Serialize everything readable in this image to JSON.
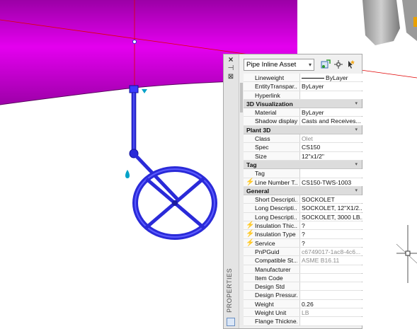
{
  "palette": {
    "title": "PROPERTIES",
    "selector_value": "Pipe Inline Asset",
    "close_glyph": "×",
    "autohide_glyph": "⊣",
    "properties_glyph": "⊠"
  },
  "rows": [
    {
      "type": "row",
      "label": "Lineweight",
      "value": "ByLayer",
      "lineweight": true
    },
    {
      "type": "row",
      "label": "EntityTranspar...",
      "value": "ByLayer"
    },
    {
      "type": "row",
      "label": "Hyperlink",
      "value": ""
    },
    {
      "type": "cat",
      "label": "3D Visualization"
    },
    {
      "type": "row",
      "label": "Material",
      "value": "ByLayer"
    },
    {
      "type": "row",
      "label": "Shadow display",
      "value": "Casts and Receives..."
    },
    {
      "type": "cat",
      "label": "Plant 3D"
    },
    {
      "type": "row",
      "label": "Class",
      "value": "Olet",
      "grey": true
    },
    {
      "type": "row",
      "label": "Spec",
      "value": "CS150"
    },
    {
      "type": "row",
      "label": "Size",
      "value": "12\"x1/2\""
    },
    {
      "type": "cat",
      "label": "Tag"
    },
    {
      "type": "row",
      "label": "Tag",
      "value": ""
    },
    {
      "type": "row",
      "label": "Line Number T...",
      "value": "CS150-TWS-1003",
      "bolt": true
    },
    {
      "type": "cat",
      "label": "General"
    },
    {
      "type": "row",
      "label": "Short Descripti...",
      "value": "SOCKOLET"
    },
    {
      "type": "row",
      "label": "Long Descripti...",
      "value": "SOCKOLET, 12\"X1/2..."
    },
    {
      "type": "row",
      "label": "Long Descripti...",
      "value": "SOCKOLET, 3000 LB..."
    },
    {
      "type": "row",
      "label": "Insulation Thic...",
      "value": "?",
      "bolt": true
    },
    {
      "type": "row",
      "label": "Insulation Type",
      "value": "?",
      "bolt": true
    },
    {
      "type": "row",
      "label": "Service",
      "value": "?",
      "bolt": true
    },
    {
      "type": "row",
      "label": "PnPGuid",
      "value": "c6749017-1ac8-4c6...",
      "grey": true
    },
    {
      "type": "row",
      "label": "Compatible St...",
      "value": "ASME B16.11",
      "grey": true
    },
    {
      "type": "row",
      "label": "Manufacturer",
      "value": ""
    },
    {
      "type": "row",
      "label": "Item Code",
      "value": ""
    },
    {
      "type": "row",
      "label": "Design Std",
      "value": ""
    },
    {
      "type": "row",
      "label": "Design Pressur...",
      "value": ""
    },
    {
      "type": "row",
      "label": "Weight",
      "value": "0.26"
    },
    {
      "type": "row",
      "label": "Weight Unit",
      "value": "LB",
      "grey": true
    },
    {
      "type": "row",
      "label": "Flange Thickne...",
      "value": ""
    }
  ],
  "colors": {
    "pipe": "#c800d2",
    "valve": "#2a2ad8",
    "bolt": "#f2a81d"
  },
  "icons": {
    "lightning": "⚡",
    "chevron": "▾"
  }
}
